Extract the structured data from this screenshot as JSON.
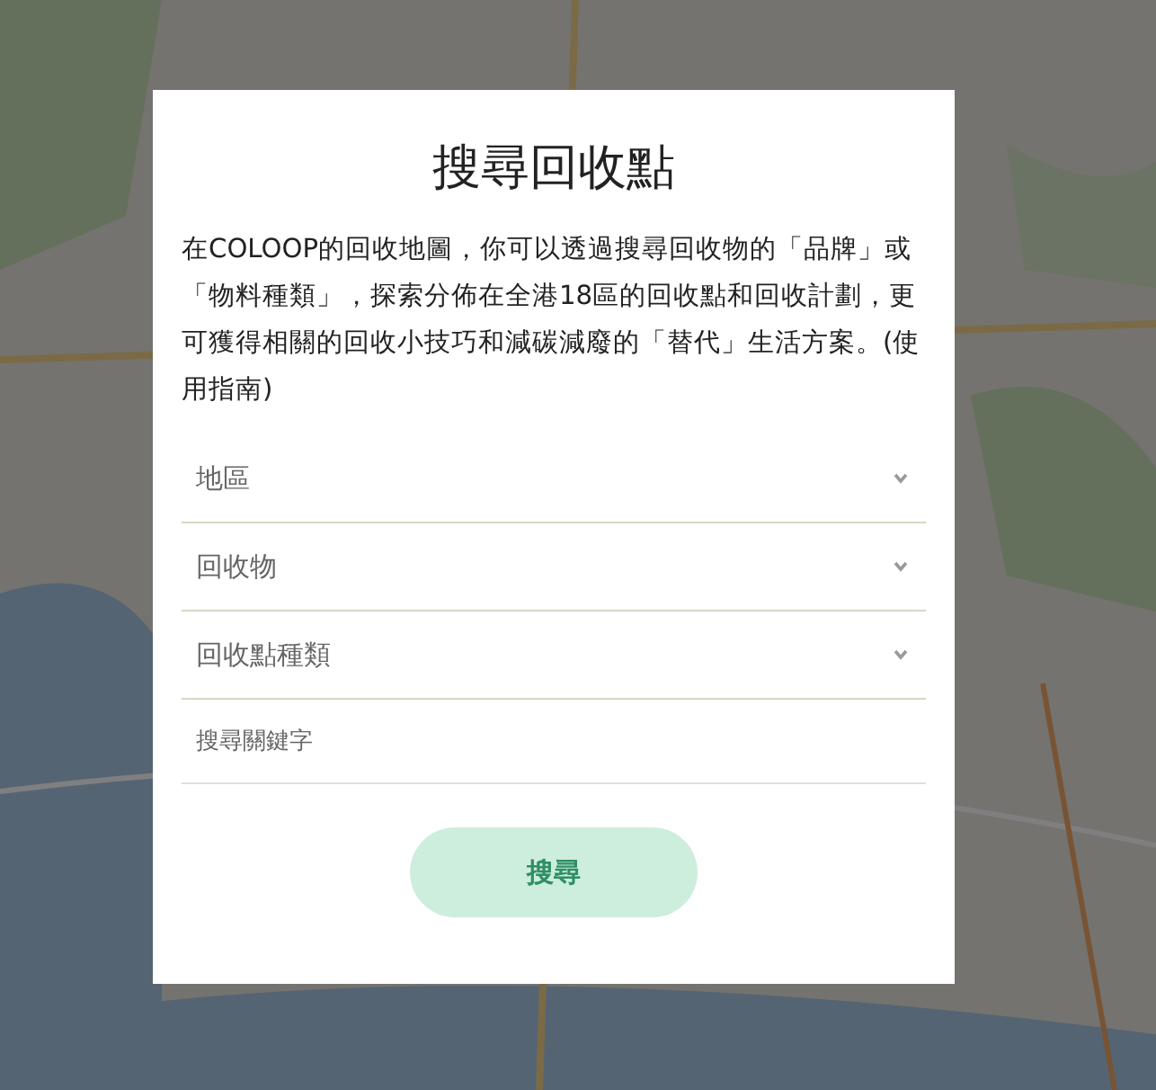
{
  "dialog": {
    "title": "搜尋回收點",
    "description": "在COLOOP的回收地圖，你可以透過搜尋回收物的「品牌」或「物料種類」，探索分佈在全港18區的回收點和回收計劃，更可獲得相關的回收小技巧和減碳減廢的「替代」生活方案。(使用指南)",
    "filters": [
      {
        "kind": "select",
        "label": "地區"
      },
      {
        "kind": "select",
        "label": "回收物"
      },
      {
        "kind": "select",
        "label": "回收點種類"
      },
      {
        "kind": "text",
        "placeholder": "搜尋關鍵字"
      }
    ],
    "search_button": {
      "label": "搜尋",
      "disabled": true
    }
  }
}
